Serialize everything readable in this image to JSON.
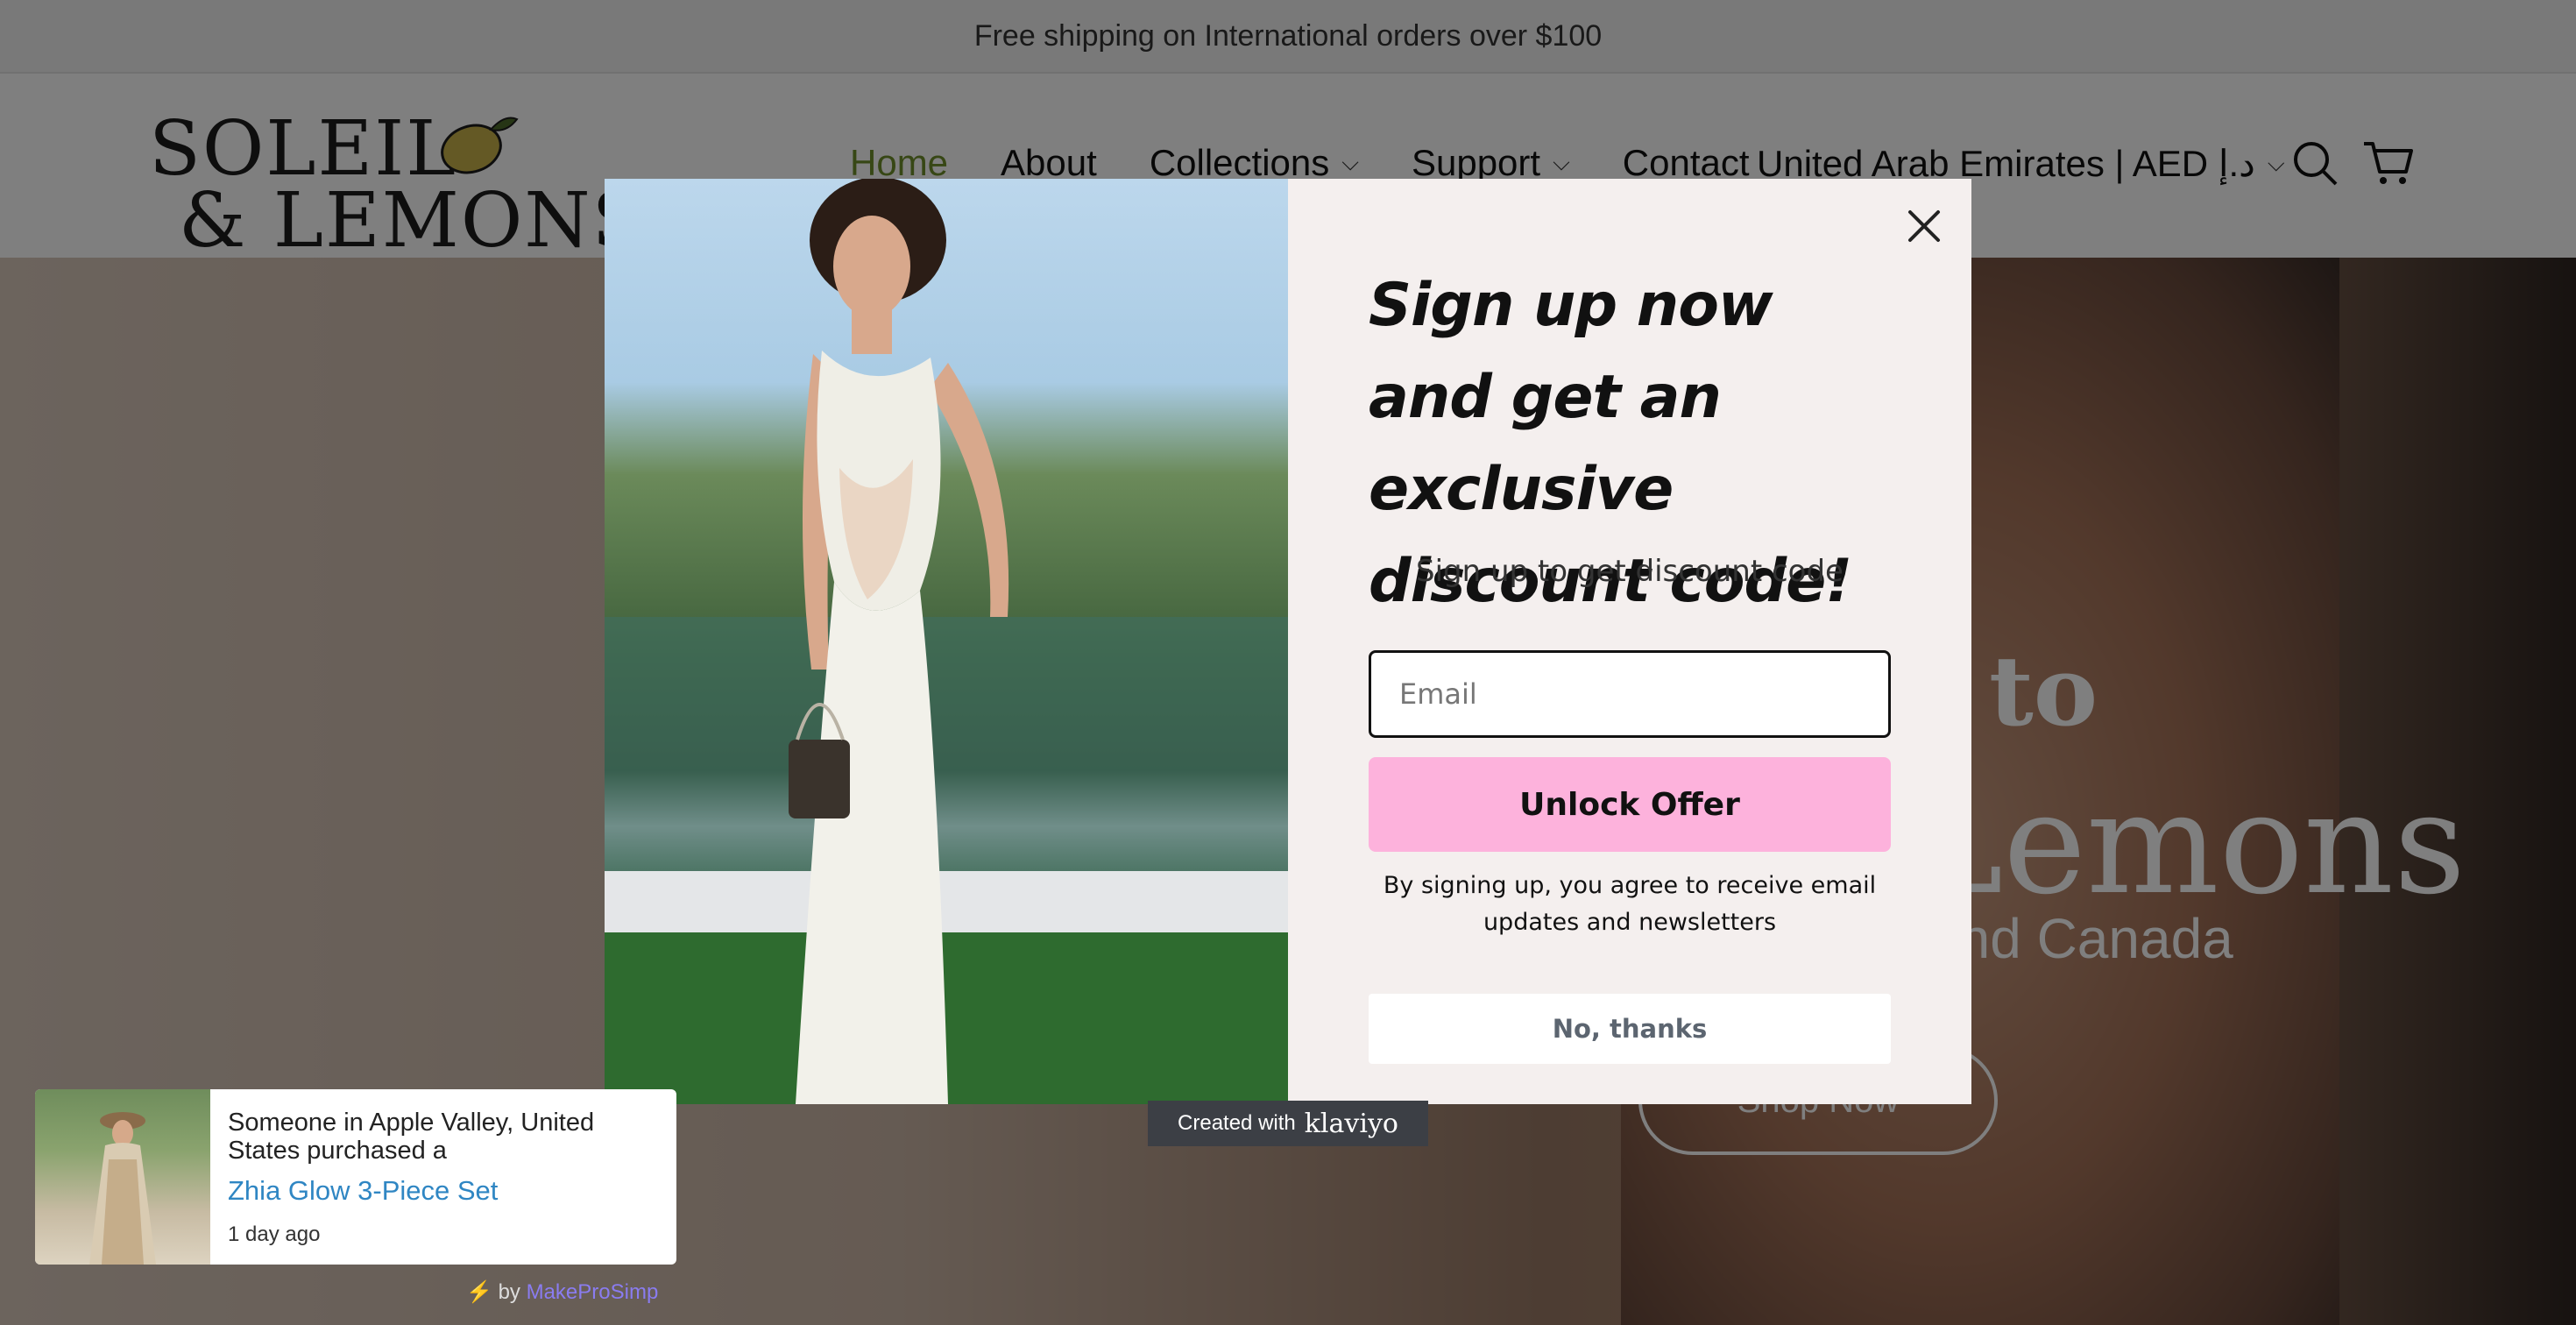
{
  "announcement": "Free shipping on International orders over $100",
  "logo": {
    "line1": "SOLEIL",
    "line2": "& LEMONS"
  },
  "nav": {
    "items": [
      {
        "label": "Home",
        "dropdown": false,
        "active": true
      },
      {
        "label": "About",
        "dropdown": false,
        "active": false
      },
      {
        "label": "Collections",
        "dropdown": true,
        "active": false
      },
      {
        "label": "Support",
        "dropdown": true,
        "active": false
      },
      {
        "label": "Contact",
        "dropdown": false,
        "active": false
      }
    ],
    "country": "United Arab Emirates | AED د.إ"
  },
  "hero": {
    "title_part": "to",
    "brand_part": "Lemons",
    "sub": "and Canada",
    "cta": "Shop Now"
  },
  "modal": {
    "headline": "Sign up now and get an exclusive discount code!",
    "subline": "Sign up to get discount code",
    "email_placeholder": "Email",
    "unlock_label": "Unlock Offer",
    "consent": "By signing up, you agree to receive email updates and newsletters",
    "no_thanks_label": "No, thanks"
  },
  "klaviyo": {
    "prefix": "Created with",
    "brand": "klaviyo"
  },
  "social_proof": {
    "line": "Someone in Apple Valley, United States purchased a",
    "product": "Zhia Glow 3-Piece Set",
    "time": "1 day ago",
    "credit_prefix": "by",
    "credit_brand": "MakeProSimp"
  },
  "colors": {
    "accent_pink": "#fdb2dc",
    "nav_active": "#6f8f2a",
    "link_blue": "#2f86c3",
    "modal_bg": "#f4efee"
  }
}
